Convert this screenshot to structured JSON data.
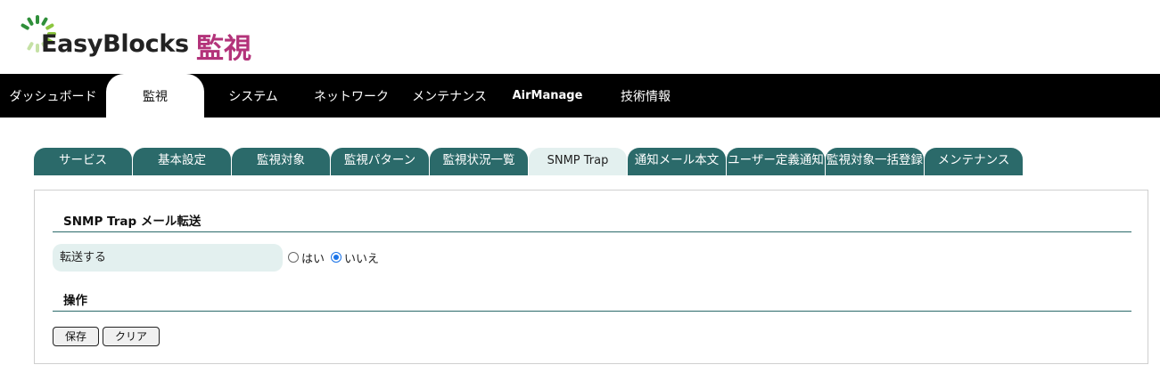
{
  "logo": {
    "brand": "EasyBlocks",
    "subtitle": "監視",
    "ring_colors": [
      "#2f8f3a",
      "#8cc63f",
      "#c5e1a5"
    ]
  },
  "nav": {
    "items": [
      "ダッシュボード",
      "監視",
      "システム",
      "ネットワーク",
      "メンテナンス",
      "AirManage",
      "技術情報"
    ],
    "active_index": 1
  },
  "tabs": {
    "items": [
      "サービス",
      "基本設定",
      "監視対象",
      "監視パターン",
      "監視状況一覧",
      "SNMP Trap",
      "通知メール本文",
      "ユーザー定義通知",
      "監視対象一括登録",
      "メンテナンス"
    ],
    "active_index": 5
  },
  "panel": {
    "section_title": "SNMP Trap メール転送",
    "field_label": "転送する",
    "option_yes": "はい",
    "option_no": "いいえ",
    "selected": "いいえ",
    "ops_title": "操作",
    "save_label": "保存",
    "clear_label": "クリア"
  },
  "colors": {
    "tab_bg": "#2b6a6a",
    "tab_active_bg": "#e3f0ef",
    "brand_accent": "#b3337a",
    "nav_bg": "#000000"
  }
}
